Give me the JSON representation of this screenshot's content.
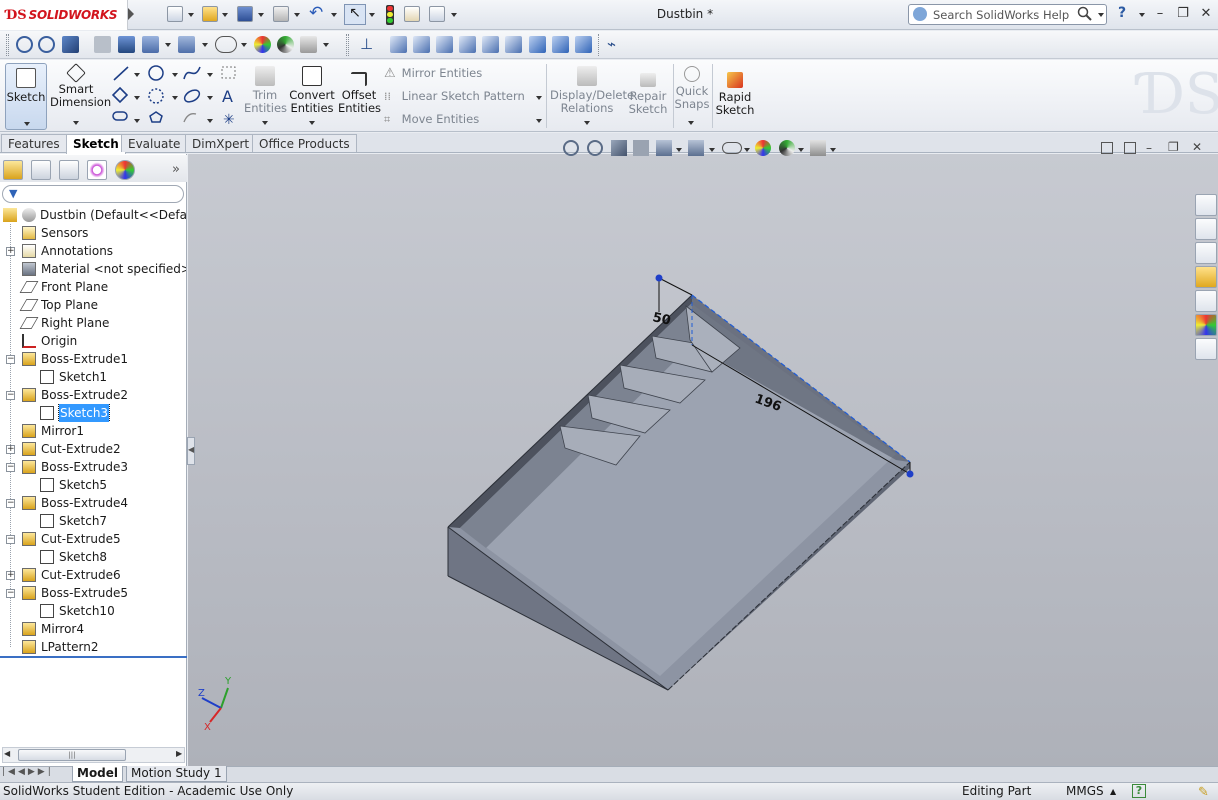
{
  "app": {
    "brand": "SOLIDWORKS",
    "doc_title": "Dustbin *"
  },
  "search": {
    "placeholder": "Search SolidWorks Help"
  },
  "command_manager": {
    "sketch": "Sketch",
    "smart_dimension": [
      "Smart",
      "Dimension"
    ],
    "trim_entities": [
      "Trim",
      "Entities"
    ],
    "convert_entities": [
      "Convert",
      "Entities"
    ],
    "offset_entities": [
      "Offset",
      "Entities"
    ],
    "mirror_entities": "Mirror Entities",
    "linear_sketch_pattern": "Linear Sketch Pattern",
    "move_entities": "Move Entities",
    "display_delete_relations": [
      "Display/Delete",
      "Relations"
    ],
    "repair_sketch": [
      "Repair",
      "Sketch"
    ],
    "quick_snaps": [
      "Quick",
      "Snaps"
    ],
    "rapid_sketch": [
      "Rapid",
      "Sketch"
    ]
  },
  "tabs": [
    "Features",
    "Sketch",
    "Evaluate",
    "DimXpert",
    "Office Products"
  ],
  "active_tab": "Sketch",
  "tree": {
    "root": "Dustbin  (Default<<Default>",
    "items": [
      {
        "label": "Sensors",
        "icon": "sensor-icon"
      },
      {
        "label": "Annotations",
        "icon": "annotation-icon"
      },
      {
        "label": "Material <not specified>",
        "icon": "material-icon"
      },
      {
        "label": "Front Plane",
        "icon": "plane-icon"
      },
      {
        "label": "Top Plane",
        "icon": "plane-icon"
      },
      {
        "label": "Right Plane",
        "icon": "plane-icon"
      },
      {
        "label": "Origin",
        "icon": "origin-icon"
      },
      {
        "label": "Boss-Extrude1",
        "icon": "extrude-icon"
      },
      {
        "label": "Sketch1",
        "icon": "sketch-icon"
      },
      {
        "label": "Boss-Extrude2",
        "icon": "extrude-icon"
      },
      {
        "label": "Sketch3",
        "icon": "sketch-icon"
      },
      {
        "label": "Mirror1",
        "icon": "mirror-icon"
      },
      {
        "label": "Cut-Extrude2",
        "icon": "cut-icon"
      },
      {
        "label": "Boss-Extrude3",
        "icon": "extrude-icon"
      },
      {
        "label": "Sketch5",
        "icon": "sketch-icon"
      },
      {
        "label": "Boss-Extrude4",
        "icon": "extrude-icon"
      },
      {
        "label": "Sketch7",
        "icon": "sketch-icon"
      },
      {
        "label": "Cut-Extrude5",
        "icon": "cut-icon"
      },
      {
        "label": "Sketch8",
        "icon": "sketch-icon"
      },
      {
        "label": "Cut-Extrude6",
        "icon": "cut-icon"
      },
      {
        "label": "Boss-Extrude5",
        "icon": "extrude-icon"
      },
      {
        "label": "Sketch10",
        "icon": "sketch-icon"
      },
      {
        "label": "Mirror4",
        "icon": "mirror-icon"
      },
      {
        "label": "LPattern2",
        "icon": "pattern-icon"
      }
    ],
    "selected": "Sketch3"
  },
  "viewport": {
    "dimension_1": "50",
    "dimension_2": "196"
  },
  "bottom_tabs": [
    "Model",
    "Motion Study 1"
  ],
  "status": {
    "edition": "SolidWorks Student Edition - Academic Use Only",
    "mode": "Editing Part",
    "units": "MMGS"
  },
  "colors": {
    "accent": "#3399ff",
    "brand_red": "#d2141d",
    "sketch_blue": "#1f5cd6"
  }
}
